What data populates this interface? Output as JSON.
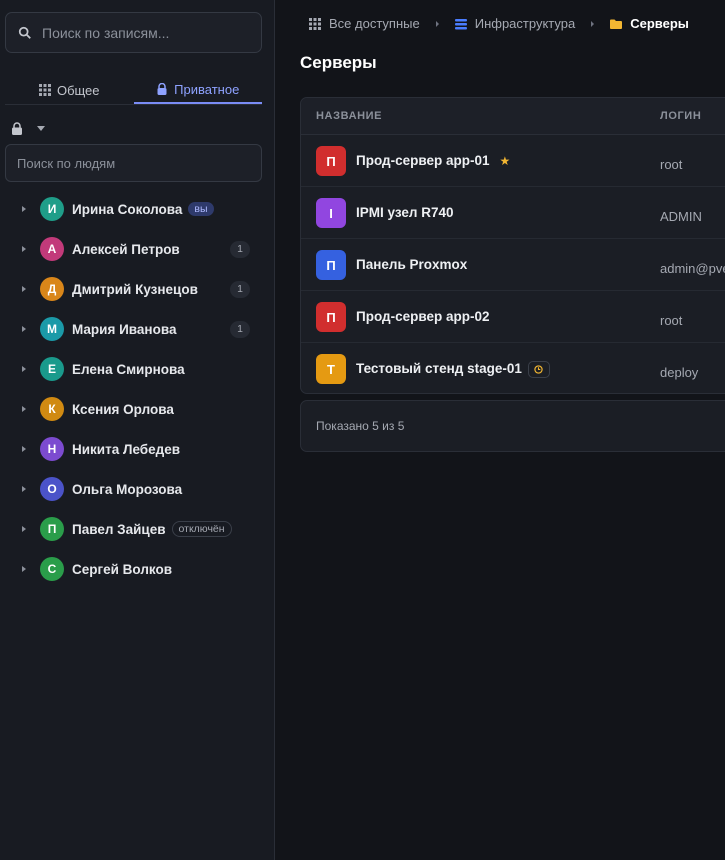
{
  "sidebar": {
    "search_placeholder": "Поиск по записям...",
    "tabs": [
      {
        "label": "Общее",
        "icon": "grid-icon",
        "active": false
      },
      {
        "label": "Приватное",
        "icon": "lock-icon",
        "active": true
      }
    ],
    "people_search_placeholder": "Поиск по людям",
    "people": [
      {
        "initial": "И",
        "name": "Ирина Соколова",
        "color": "#1f9e89",
        "tag": "вы",
        "tag_type": "you"
      },
      {
        "initial": "А",
        "name": "Алексей Петров",
        "color": "#c23a7a",
        "count": "1"
      },
      {
        "initial": "Д",
        "name": "Дмитрий Кузнецов",
        "color": "#d9861a",
        "count": "1"
      },
      {
        "initial": "М",
        "name": "Мария Иванова",
        "color": "#1b9aa8",
        "count": "1"
      },
      {
        "initial": "Е",
        "name": "Елена Смирнова",
        "color": "#1a9a8c"
      },
      {
        "initial": "К",
        "name": "Ксения Орлова",
        "color": "#d08a12"
      },
      {
        "initial": "Н",
        "name": "Никита Лебедев",
        "color": "#7c4bd0"
      },
      {
        "initial": "О",
        "name": "Ольга Морозова",
        "color": "#4b53c9"
      },
      {
        "initial": "П",
        "name": "Павел Зайцев",
        "color": "#2a9d4a",
        "tag": "отключён",
        "tag_type": "off"
      },
      {
        "initial": "С",
        "name": "Сергей Волков",
        "color": "#2a9d4a"
      }
    ]
  },
  "breadcrumbs": [
    {
      "label": "Все доступные",
      "icon": "grid-icon"
    },
    {
      "label": "Инфраструктура",
      "icon": "stack-icon"
    },
    {
      "label": "Серверы",
      "icon": "folder-icon"
    }
  ],
  "page_title": "Серверы",
  "table": {
    "col_name": "НАЗВАНИЕ",
    "col_login": "ЛОГИН",
    "rows": [
      {
        "initial": "П",
        "name": "Прод-сервер app-01",
        "login": "root",
        "color": "#d12e2e",
        "badge": "star"
      },
      {
        "initial": "I",
        "name": "IPMI узел R740",
        "login": "ADMIN",
        "color": "#9146e0"
      },
      {
        "initial": "П",
        "name": "Панель Proxmox",
        "login": "admin@pve",
        "color": "#3561e0"
      },
      {
        "initial": "П",
        "name": "Прод-сервер app-02",
        "login": "root",
        "color": "#d12e2e"
      },
      {
        "initial": "Т",
        "name": "Тестовый стенд stage-01",
        "login": "deploy",
        "color": "#e59a12",
        "badge": "clock"
      }
    ],
    "footer": "Показано 5 из 5"
  },
  "colors": {
    "accent": "#7a8cf5",
    "star": "#f2b632"
  }
}
